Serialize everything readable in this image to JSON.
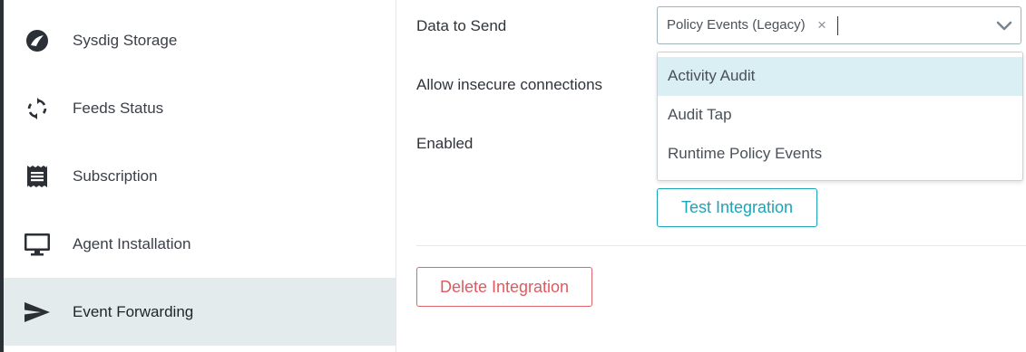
{
  "sidebar": {
    "items": [
      {
        "label": "Sysdig Storage",
        "icon": "sysdig-storage-icon",
        "active": false
      },
      {
        "label": "Feeds Status",
        "icon": "refresh-icon",
        "active": false
      },
      {
        "label": "Subscription",
        "icon": "receipt-icon",
        "active": false
      },
      {
        "label": "Agent Installation",
        "icon": "monitor-icon",
        "active": false
      },
      {
        "label": "Event Forwarding",
        "icon": "send-icon",
        "active": true
      }
    ]
  },
  "form": {
    "data_to_send_label": "Data to Send",
    "allow_insecure_label": "Allow insecure connections",
    "enabled_label": "Enabled",
    "selected_chip": "Policy Events (Legacy)",
    "chip_remove_glyph": "×",
    "dropdown_options": [
      "Activity Audit",
      "Audit Tap",
      "Runtime Policy Events"
    ],
    "highlighted_option": "Activity Audit",
    "test_button": "Test Integration",
    "delete_button": "Delete Integration"
  },
  "colors": {
    "accent": "#1aa6b7",
    "danger": "#e0595f",
    "active_row": "#e4ebec",
    "highlight_row": "#d9eff3"
  }
}
